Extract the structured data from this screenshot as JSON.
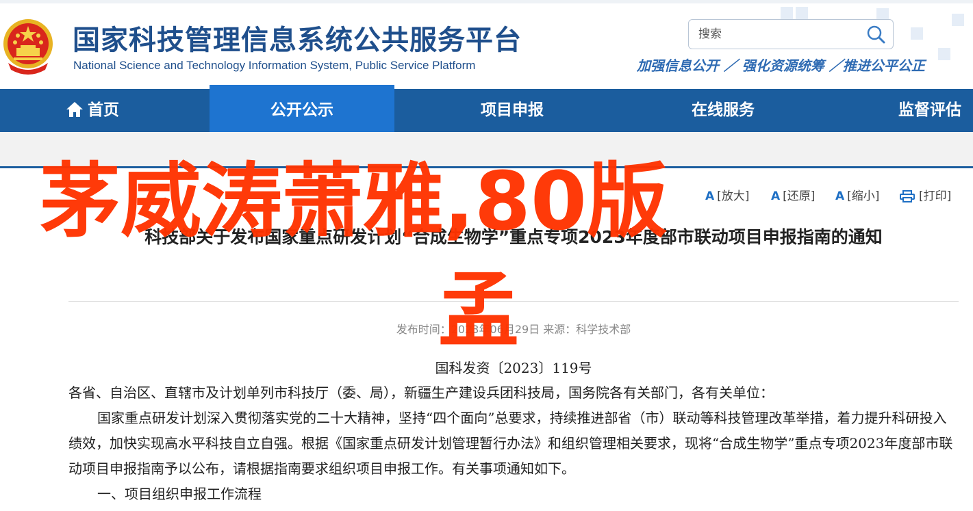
{
  "header": {
    "title": "国家科技管理信息系统公共服务平台",
    "subtitle": "National Science and Technology Information System, Public Service Platform",
    "search_placeholder": "搜索",
    "slogan": "加强信息公开 ／ 强化资源统筹 ／推进公平公正"
  },
  "nav": {
    "items": [
      {
        "label": "首页"
      },
      {
        "label": "公开公示"
      },
      {
        "label": "项目申报"
      },
      {
        "label": "在线服务"
      },
      {
        "label": "监督评估"
      }
    ]
  },
  "tools": {
    "enlarge": "[放大]",
    "restore": "[还原]",
    "shrink": "[缩小]",
    "print": "[打印]"
  },
  "article": {
    "title": "科技部关于发布国家重点研发计划“合成生物学”重点专项2023年度部市联动项目申报指南的通知",
    "meta": "发布时间：2023年06月29日 来源：科学技术部",
    "doc_no": "国科发资〔2023〕119号",
    "paragraphs": [
      "各省、自治区、直辖市及计划单列市科技厅（委、局），新疆生产建设兵团科技局，国务院各有关部门，各有关单位：",
      "国家重点研发计划深入贯彻落实党的二十大精神，坚持“四个面向”总要求，持续推进部省（市）联动等科技管理改革举措，着力提升科研投入绩效，加快实现高水平科技自立自强。根据《国家重点研发计划管理暂行办法》和组织管理相关要求，现将“合成生物学”重点专项2023年度部市联动项目申报指南予以公布，请根据指南要求组织项目申报工作。有关事项通知如下。",
      "一、项目组织申报工作流程"
    ]
  },
  "overlay": {
    "line1": "茅威涛萧雅,80版",
    "line2": "孟"
  }
}
